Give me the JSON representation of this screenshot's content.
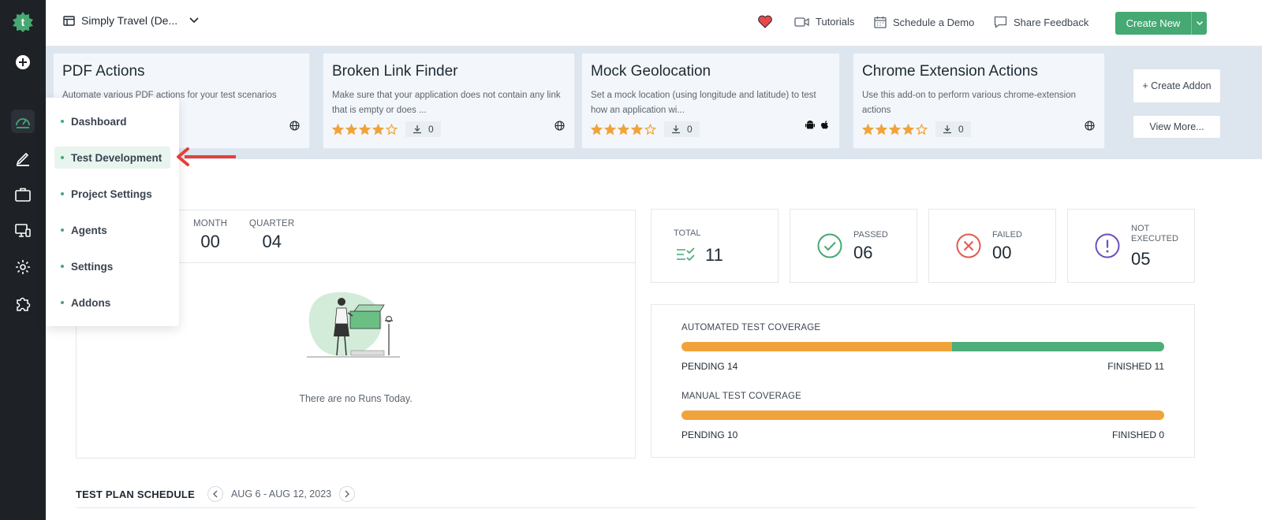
{
  "app": {
    "logo_letter": "t",
    "accent": "#46a873"
  },
  "rail": {
    "icons": [
      "logo-icon",
      "add-circle-icon",
      "dashboard-gauge-icon",
      "pen-icon",
      "briefcase-icon",
      "monitor-agents-icon",
      "gear-icon",
      "puzzle-icon"
    ]
  },
  "topbar": {
    "project_name": "Simply Travel (De...",
    "tutorials": "Tutorials",
    "schedule_demo": "Schedule a Demo",
    "share_feedback": "Share Feedback",
    "create_new": "Create New"
  },
  "addons": [
    {
      "title": "PDF Actions",
      "desc": "Automate various PDF actions for your test scenarios",
      "downloads": "",
      "rating": 0,
      "platform": "globe-icon"
    },
    {
      "title": "Broken Link Finder",
      "desc": "Make sure that your application does not contain any link that is empty or does ...",
      "downloads": "0",
      "rating": 4,
      "platform": "globe-icon"
    },
    {
      "title": "Mock Geolocation",
      "desc": "Set a mock location (using longitude and latitude) to test how an application wi...",
      "downloads": "0",
      "rating": 4,
      "platform": "android-apple-icons"
    },
    {
      "title": "Chrome Extension Actions",
      "desc": "Use this add-on to perform various chrome-extension actions",
      "downloads": "0",
      "rating": 4,
      "platform": "globe-icon"
    }
  ],
  "addon_side": {
    "create": "+ Create Addon",
    "view_more": "View More..."
  },
  "runs": {
    "month_label": "MONTH",
    "month_value": "00",
    "quarter_label": "QUARTER",
    "quarter_value": "04",
    "empty_message": "There are no Runs Today."
  },
  "results": {
    "total_label": "TOTAL",
    "total_value": "11",
    "passed_label": "PASSED",
    "passed_value": "06",
    "failed_label": "FAILED",
    "failed_value": "00",
    "not_executed_label": "NOT EXECUTED",
    "not_executed_value": "05",
    "colors": {
      "passed": "#46a873",
      "failed": "#e05a4e",
      "not_executed": "#6c4fbf"
    }
  },
  "coverage": {
    "automated_label": "AUTOMATED TEST COVERAGE",
    "automated_pending": "PENDING 14",
    "automated_finished": "FINISHED 11",
    "automated_finished_fraction": 0.44,
    "manual_label": "MANUAL TEST COVERAGE",
    "manual_pending": "PENDING 10",
    "manual_finished": "FINISHED 0",
    "manual_finished_fraction": 0
  },
  "schedule": {
    "title": "TEST PLAN SCHEDULE",
    "range": "AUG 6 - AUG 12, 2023"
  },
  "menu": {
    "items": [
      "Dashboard",
      "Test Development",
      "Project Settings",
      "Agents",
      "Settings",
      "Addons"
    ],
    "active": "Test Development"
  }
}
